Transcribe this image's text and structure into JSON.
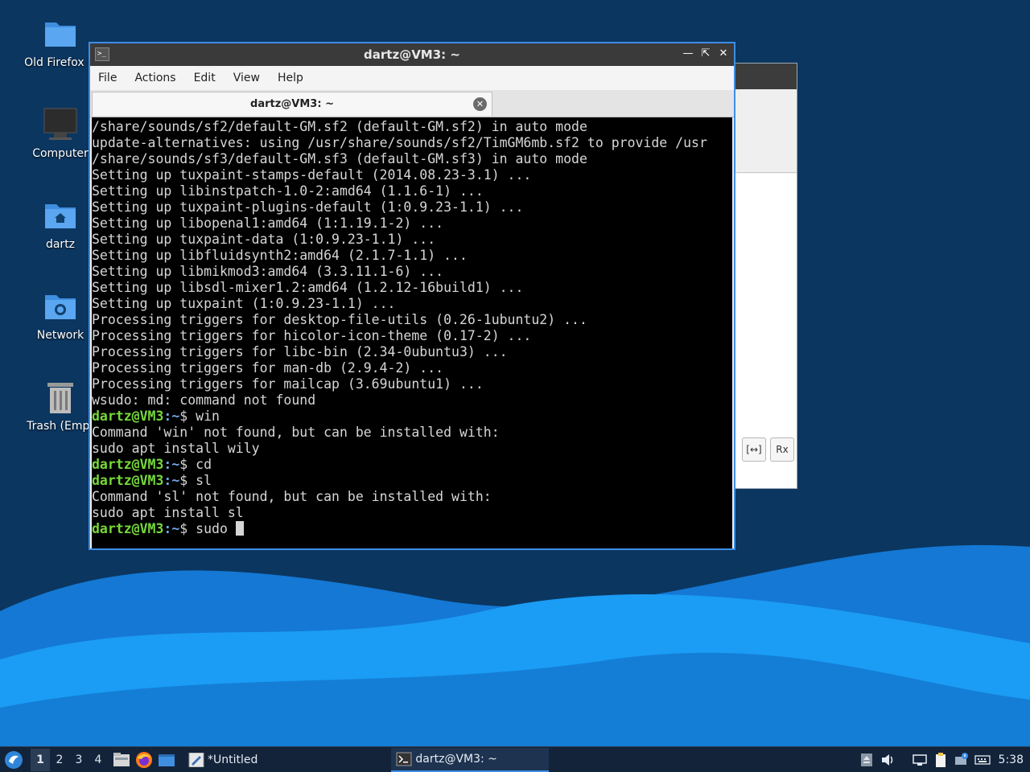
{
  "desktop": {
    "icons": [
      {
        "label": "Old Firefox D",
        "icon": "folder-icon"
      },
      {
        "label": "Computer",
        "icon": "computer-icon"
      },
      {
        "label": "dartz",
        "icon": "home-folder-icon"
      },
      {
        "label": "Network",
        "icon": "network-folder-icon"
      },
      {
        "label": "Trash (Empt",
        "icon": "trash-icon"
      }
    ]
  },
  "background_window": {
    "buttons": [
      "[↔]",
      "Rx"
    ]
  },
  "terminal": {
    "title": "dartz@VM3: ~",
    "menu": [
      "File",
      "Actions",
      "Edit",
      "View",
      "Help"
    ],
    "tab_label": "dartz@VM3: ~",
    "prompt_user": "dartz@VM3",
    "prompt_path": ":~",
    "prompt_symbol": "$",
    "lines": [
      {
        "type": "out",
        "text": "/share/sounds/sf2/default-GM.sf2 (default-GM.sf2) in auto mode"
      },
      {
        "type": "out",
        "text": "update-alternatives: using /usr/share/sounds/sf2/TimGM6mb.sf2 to provide /usr"
      },
      {
        "type": "out",
        "text": "/share/sounds/sf3/default-GM.sf3 (default-GM.sf3) in auto mode"
      },
      {
        "type": "out",
        "text": "Setting up tuxpaint-stamps-default (2014.08.23-3.1) ..."
      },
      {
        "type": "out",
        "text": "Setting up libinstpatch-1.0-2:amd64 (1.1.6-1) ..."
      },
      {
        "type": "out",
        "text": "Setting up tuxpaint-plugins-default (1:0.9.23-1.1) ..."
      },
      {
        "type": "out",
        "text": "Setting up libopenal1:amd64 (1:1.19.1-2) ..."
      },
      {
        "type": "out",
        "text": "Setting up tuxpaint-data (1:0.9.23-1.1) ..."
      },
      {
        "type": "out",
        "text": "Setting up libfluidsynth2:amd64 (2.1.7-1.1) ..."
      },
      {
        "type": "out",
        "text": "Setting up libmikmod3:amd64 (3.3.11.1-6) ..."
      },
      {
        "type": "out",
        "text": "Setting up libsdl-mixer1.2:amd64 (1.2.12-16build1) ..."
      },
      {
        "type": "out",
        "text": "Setting up tuxpaint (1:0.9.23-1.1) ..."
      },
      {
        "type": "out",
        "text": "Processing triggers for desktop-file-utils (0.26-1ubuntu2) ..."
      },
      {
        "type": "out",
        "text": "Processing triggers for hicolor-icon-theme (0.17-2) ..."
      },
      {
        "type": "out",
        "text": "Processing triggers for libc-bin (2.34-0ubuntu3) ..."
      },
      {
        "type": "out",
        "text": "Processing triggers for man-db (2.9.4-2) ..."
      },
      {
        "type": "out",
        "text": "Processing triggers for mailcap (3.69ubuntu1) ..."
      },
      {
        "type": "out",
        "text": "wsudo: md: command not found"
      },
      {
        "type": "prompt",
        "text": " win"
      },
      {
        "type": "out",
        "text": "Command 'win' not found, but can be installed with:"
      },
      {
        "type": "out",
        "text": "sudo apt install wily"
      },
      {
        "type": "prompt",
        "text": " cd"
      },
      {
        "type": "prompt",
        "text": " sl"
      },
      {
        "type": "out",
        "text": "Command 'sl' not found, but can be installed with:"
      },
      {
        "type": "out",
        "text": "sudo apt install sl"
      },
      {
        "type": "prompt",
        "text": " sudo ",
        "cursor": true
      }
    ]
  },
  "taskbar": {
    "workspaces": [
      "1",
      "2",
      "3",
      "4"
    ],
    "active_workspace": "1",
    "tasks": [
      {
        "label": "*Untitled",
        "icon": "text-editor-icon"
      },
      {
        "label": "dartz@VM3: ~",
        "icon": "terminal-icon"
      }
    ],
    "clock": "5:38"
  },
  "colors": {
    "wallpaper_dark": "#0b3660",
    "wave_light": "#1b9cf5",
    "wave_mid": "#1478d4",
    "window_accent": "#3d8ee6",
    "prompt_green": "#76d83a",
    "prompt_blue": "#6ea7e8"
  }
}
